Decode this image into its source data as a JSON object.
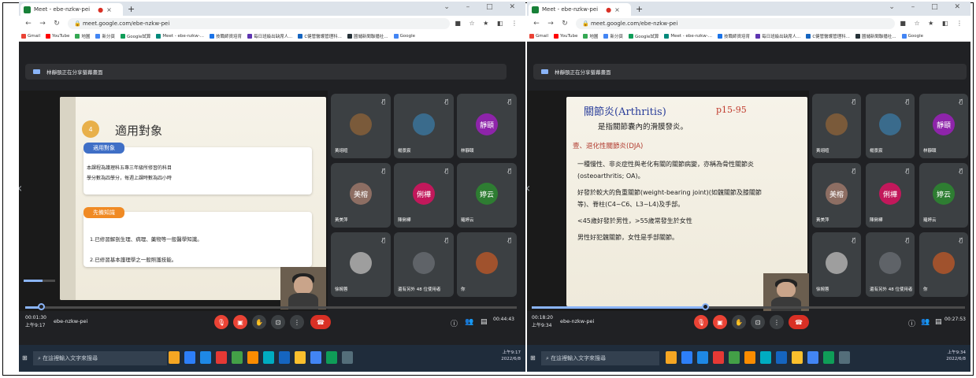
{
  "left": {
    "tab_title": "Meet - ebe-nzkw-pei",
    "url": "meet.google.com/ebe-nzkw-pei",
    "bookmarks": [
      "Gmail",
      "YouTube",
      "地圖",
      "新分頁",
      "Google試算",
      "Meet - ebe-nzkw-...",
      "技職師資培育",
      "每日班級出缺席人...",
      "C健管醫護管理科...",
      "國儲新聞聯播社...",
      "Google"
    ],
    "share_text": "林靜頤正在分享螢幕畫面",
    "slide": {
      "number": "4",
      "title": "適用對象",
      "sec1": "適用對象",
      "bullets": [
        "本課程為護理科五專三年級所修習的科目",
        "學分數為四學分，每週上課時數為四小時"
      ],
      "sec2": "先備知識",
      "items": [
        "1.已修習解剖生理、病理、藥物等一般醫學知識。",
        "2.已修習基本護理學之一般照護技能。"
      ]
    },
    "tiles": [
      {
        "name": "黃翊暄",
        "initial": "",
        "color": "#7a5a3a"
      },
      {
        "name": "楊景宸",
        "initial": "",
        "color": "#3a6b8c"
      },
      {
        "name": "林靜頤",
        "initial": "靜頤",
        "color": "#8e24aa"
      },
      {
        "name": "黃美萍",
        "initial": "美榕",
        "color": "#8d6e63"
      },
      {
        "name": "陳俐樺",
        "initial": "俐樺",
        "color": "#c2185b"
      },
      {
        "name": "羅婷云",
        "initial": "婷云",
        "color": "#2e7d32"
      },
      {
        "name": "徐婉蓉",
        "initial": "",
        "color": "#9e9e9e"
      },
      {
        "name": "還有另外 48 位使用者",
        "initial": "",
        "color": "#5f6368"
      },
      {
        "name": "你",
        "initial": "",
        "color": "#a0522d"
      }
    ],
    "time": "00:01:30",
    "clock": "上午9:17",
    "meeting_code": "ebe-nzkw-pei",
    "duration": "00:44:43",
    "taskbar_search": "在這裡輸入文字來搜尋",
    "tray": "上午9:17\n2022/6/8"
  },
  "right": {
    "tab_title": "Meet - ebe-nzkw-pei",
    "url": "meet.google.com/ebe-nzkw-pei",
    "bookmarks": [
      "Gmail",
      "YouTube",
      "地圖",
      "新分頁",
      "Google試算",
      "Meet - ebe-nzkw-...",
      "技職師資培育",
      "每日班級出缺席人...",
      "C健管醫護管理科...",
      "國儲新聞聯播社...",
      "Google"
    ],
    "share_text": "林靜頤正在分享螢幕畫面",
    "slide": {
      "title": "關節炎(Arthritis)",
      "ref": "p15-95",
      "sub": "是指關節囊內的滑膜發炎。",
      "sec": "壹、退化性關節炎(DJA)",
      "bullets": [
        "一種慢性、非炎症性與老化有關的關節病變，亦稱為骨性關節炎(osteoarthritis; OA)。",
        "好發於較大的負重關節(weight-bearing joint)(如髖關節及膝關節等)、脊柱(C4~C6、L3~L4)及手部。",
        "<45歲好發於男性，>55歲常發生於女性",
        "男性好犯髖關節，女性是手部關節。"
      ]
    },
    "tiles": [
      {
        "name": "黃翊暄",
        "initial": "",
        "color": "#7a5a3a"
      },
      {
        "name": "楊景宸",
        "initial": "",
        "color": "#3a6b8c"
      },
      {
        "name": "林靜頤",
        "initial": "靜頤",
        "color": "#8e24aa"
      },
      {
        "name": "黃美萍",
        "initial": "美榕",
        "color": "#8d6e63"
      },
      {
        "name": "陳俐樺",
        "initial": "俐樺",
        "color": "#c2185b"
      },
      {
        "name": "羅婷云",
        "initial": "婷云",
        "color": "#2e7d32"
      },
      {
        "name": "徐婉蓉",
        "initial": "",
        "color": "#9e9e9e"
      },
      {
        "name": "還有另外 48 位使用者",
        "initial": "",
        "color": "#5f6368"
      },
      {
        "name": "你",
        "initial": "",
        "color": "#a0522d"
      }
    ],
    "time": "00:18:20",
    "clock": "上午9:34",
    "meeting_code": "ebe-nzkw-pei",
    "duration": "00:27:53",
    "taskbar_search": "在這裡輸入文字來搜尋",
    "tray": "上午9:34\n2022/6/8"
  },
  "colors": {
    "meet_bg": "#202124",
    "end_call": "#d93025",
    "accent": "#8ab4f8",
    "mic_off": "#ea4335"
  }
}
